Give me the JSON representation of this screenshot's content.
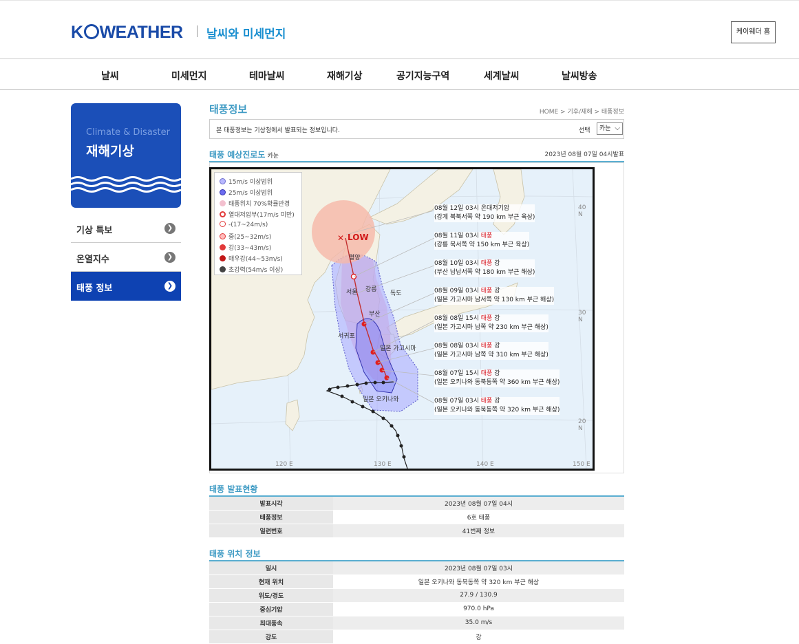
{
  "header": {
    "logo_left": "K",
    "logo_right": "WEATHER",
    "subtitle": "날씨와 미세먼지",
    "home_button": "케이웨더 홈"
  },
  "gnb": [
    "날씨",
    "미세먼지",
    "테마날씨",
    "재해기상",
    "공기지능구역",
    "세계날씨",
    "날씨방송"
  ],
  "sidebar": {
    "en_title": "Climate & Disaster",
    "ko_title": "재해기상",
    "items": [
      {
        "label": "기상 특보",
        "active": false
      },
      {
        "label": "온열지수",
        "active": false
      },
      {
        "label": "태풍 정보",
        "active": true
      }
    ]
  },
  "page": {
    "title": "태풍정보",
    "breadcrumb": "HOME > 기후/재해 > 태풍정보",
    "notice": "본 태풍정보는 기상청에서 발표되는 정보입니다.",
    "select_label": "선택",
    "select_value": "카눈"
  },
  "track_section": {
    "title": "태풍 예상진로도",
    "typhoon_name": "카눈",
    "issued": "2023년 08월 07일 04시발표"
  },
  "map": {
    "legend": [
      {
        "label": "15m/s 이상범위",
        "color": "#b8b8ff"
      },
      {
        "label": "25m/s 이상범위",
        "color": "#6c6cf0"
      },
      {
        "label": "태풍위치 70%확률반경",
        "color": "#f3c0cf"
      },
      {
        "label": "열대저압부(17m/s 미만)",
        "color": "#e23a3a"
      },
      {
        "label": "-(17~24m/s)",
        "color": "#e23a3a"
      },
      {
        "label": "중(25~32m/s)",
        "color": "#e23a3a"
      },
      {
        "label": "강(33~43m/s)",
        "color": "#e23a3a"
      },
      {
        "label": "매우강(44~53m/s)",
        "color": "#e23a3a"
      },
      {
        "label": "초강력(54m/s 이상)",
        "color": "#444444"
      }
    ],
    "low_label": "LOW",
    "places": [
      "평양",
      "서울",
      "강릉",
      "독도",
      "부산",
      "서귀포",
      "일본 가고시마",
      "일본 오키나와"
    ],
    "lat_labels": [
      "40 N",
      "30 N",
      "20 N"
    ],
    "lon_labels": [
      "120 E",
      "130 E",
      "140 E",
      "150 E"
    ],
    "annotations": [
      {
        "line1_pre": "08월 12일 03시 온대저기압",
        "line1_red": "",
        "line1_post": "",
        "line2": "(강계 북북서쪽 약 190 km 부근 육상)"
      },
      {
        "line1_pre": "08월 11일 03시 ",
        "line1_red": "태풍",
        "line1_post": "",
        "line2": "(강릉 북서쪽 약 150 km 부근 육상)"
      },
      {
        "line1_pre": "08월 10일 03시 ",
        "line1_red": "태풍",
        "line1_post": " 강",
        "line2": "(부산 남남서쪽 약 180 km 부근 해상)"
      },
      {
        "line1_pre": "08월 09일 03시 ",
        "line1_red": "태풍",
        "line1_post": " 강",
        "line2": "(일본 가고시마 남서쪽 약 130 km 부근 해상)"
      },
      {
        "line1_pre": "08월 08일 15시 ",
        "line1_red": "태풍",
        "line1_post": " 강",
        "line2": "(일본 가고시마 남쪽 약 230 km 부근 해상)"
      },
      {
        "line1_pre": "08월 08일 03시 ",
        "line1_red": "태풍",
        "line1_post": " 강",
        "line2": "(일본 가고시마 남쪽 약 310 km 부근 해상)"
      },
      {
        "line1_pre": "08월 07일 15시 ",
        "line1_red": "태풍",
        "line1_post": " 강",
        "line2": "(일본 오키나와 동북동쪽 약 360 km 부근 해상)"
      },
      {
        "line1_pre": "08월 07일 03시 ",
        "line1_red": "태풍",
        "line1_post": " 강",
        "line2": "(일본 오키나와 동북동쪽 약 320 km 부근 해상)"
      }
    ]
  },
  "announce": {
    "title": "태풍 발표현황",
    "rows": [
      {
        "k": "발표시각",
        "v": "2023년 08월 07일 04시"
      },
      {
        "k": "태풍정보",
        "v": "6호 태풍"
      },
      {
        "k": "일련번호",
        "v": "41번째 정보"
      }
    ]
  },
  "position": {
    "title": "태풍 위치 정보",
    "rows": [
      {
        "k": "일시",
        "v": "2023년 08월 07일 03시"
      },
      {
        "k": "현재 위치",
        "v": "일본 오키나와 동북동쪽 약 320 km 부근 해상"
      },
      {
        "k": "위도/경도",
        "v": "27.9 / 130.9"
      },
      {
        "k": "중심기압",
        "v": "970.0 hPa"
      },
      {
        "k": "최대풍속",
        "v": "35.0 m/s"
      },
      {
        "k": "강도",
        "v": "강"
      }
    ]
  }
}
